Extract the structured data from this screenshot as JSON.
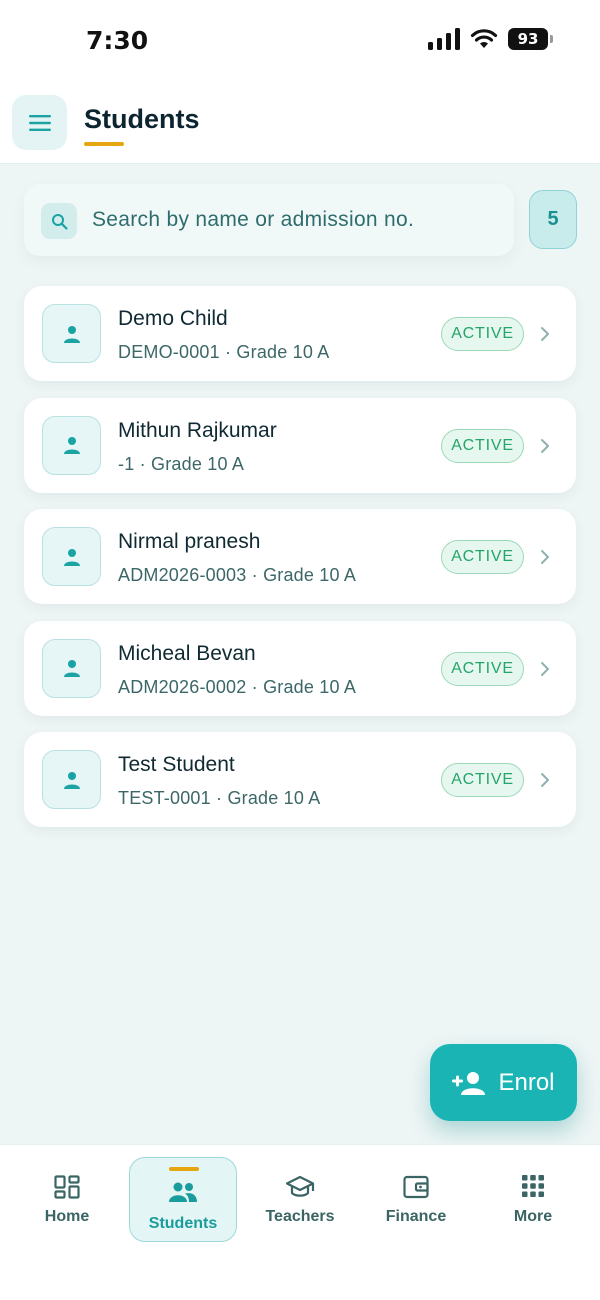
{
  "status_bar": {
    "time": "7:30",
    "battery": "93"
  },
  "header": {
    "title": "Students"
  },
  "search": {
    "placeholder": "Search by name or admission no.",
    "value": "",
    "count": "5"
  },
  "students": [
    {
      "name": "Demo Child",
      "meta": "DEMO-0001 · Grade 10 A",
      "status": "ACTIVE"
    },
    {
      "name": "Mithun Rajkumar",
      "meta": "-1 · Grade 10 A",
      "status": "ACTIVE"
    },
    {
      "name": "Nirmal pranesh",
      "meta": "ADM2026-0003 · Grade 10 A",
      "status": "ACTIVE"
    },
    {
      "name": "Micheal Bevan",
      "meta": "ADM2026-0002 · Grade 10 A",
      "status": "ACTIVE"
    },
    {
      "name": "Test Student",
      "meta": "TEST-0001 · Grade 10 A",
      "status": "ACTIVE"
    }
  ],
  "fab": {
    "label": "Enrol",
    "icon": "person-add-icon"
  },
  "nav": {
    "items": [
      {
        "label": "Home",
        "icon": "dashboard-icon"
      },
      {
        "label": "Students",
        "icon": "people-icon",
        "active": true
      },
      {
        "label": "Teachers",
        "icon": "graduation-cap-icon"
      },
      {
        "label": "Finance",
        "icon": "wallet-icon"
      },
      {
        "label": "More",
        "icon": "grid-dots-icon"
      }
    ]
  },
  "colors": {
    "accent": "#1bb4b4",
    "underline": "#e5a612",
    "active_badge": "#25a56a",
    "background": "#eef5f5"
  }
}
